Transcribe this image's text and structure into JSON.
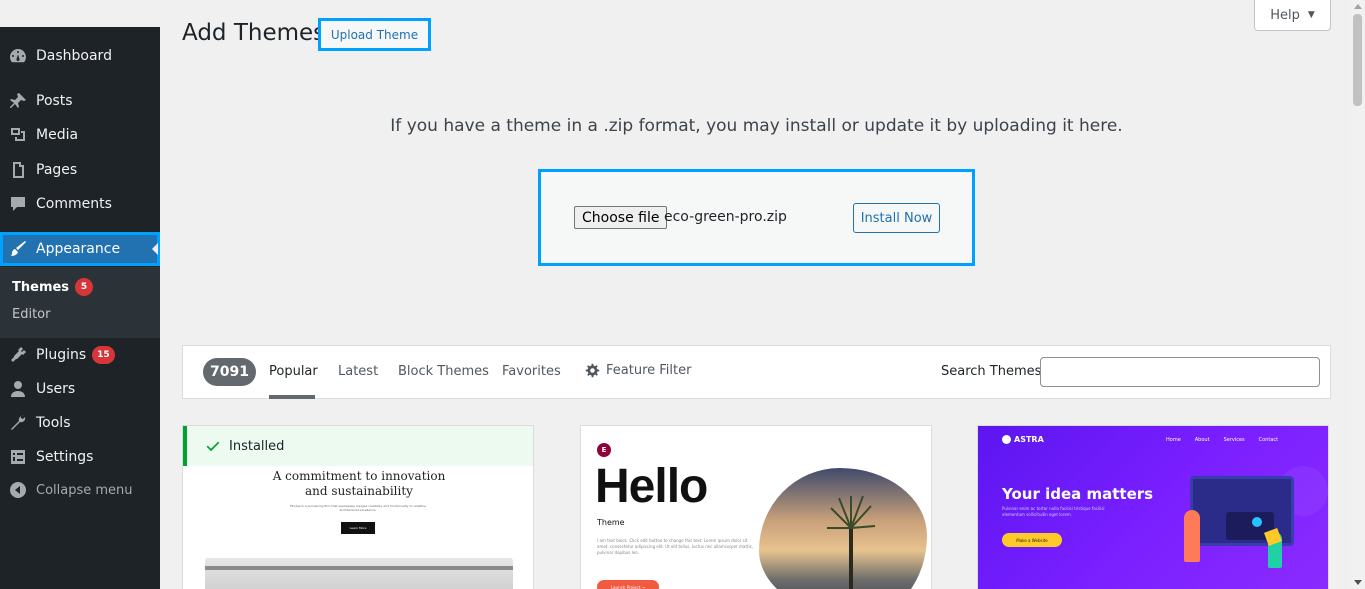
{
  "sidebar": {
    "items": [
      {
        "label": "Dashboard",
        "icon": "dashboard-icon"
      },
      {
        "label": "Posts",
        "icon": "pin-icon"
      },
      {
        "label": "Media",
        "icon": "media-icon"
      },
      {
        "label": "Pages",
        "icon": "pages-icon"
      },
      {
        "label": "Comments",
        "icon": "comments-icon"
      },
      {
        "label": "Appearance",
        "icon": "brush-icon",
        "active": true
      },
      {
        "label": "Plugins",
        "icon": "plugin-icon",
        "badge": "15"
      },
      {
        "label": "Users",
        "icon": "users-icon"
      },
      {
        "label": "Tools",
        "icon": "wrench-icon"
      },
      {
        "label": "Settings",
        "icon": "settings-icon"
      },
      {
        "label": "Collapse menu",
        "icon": "collapse-icon"
      }
    ],
    "submenu": {
      "themes_label": "Themes",
      "themes_badge": "5",
      "editor_label": "Editor"
    }
  },
  "header": {
    "title": "Add Themes",
    "upload_button": "Upload Theme",
    "help_button": "Help"
  },
  "upload": {
    "description": "If you have a theme in a .zip format, you may install or update it by uploading it here.",
    "choose_file_label": "Choose file",
    "file_name": "eco-green-pro.zip",
    "install_button": "Install Now"
  },
  "filter_bar": {
    "count": "7091",
    "tabs": [
      "Popular",
      "Latest",
      "Block Themes",
      "Favorites"
    ],
    "current_tab": "Popular",
    "feature_filter": "Feature Filter",
    "search_label": "Search Themes",
    "search_value": ""
  },
  "themes": {
    "installed_label": "Installed",
    "card1": {
      "headline_1": "A commitment to innovation",
      "headline_2": "and sustainability",
      "small_text": "Études is a pioneering firm that seamlessly merges creativity and functionality to redefine architectural excellence.",
      "button": "Learn More"
    },
    "card2": {
      "logo": "E",
      "title": "Hello",
      "subtitle": "Theme",
      "body": "I am text block. Click edit button to change this text. Lorem ipsum dolor sit amet, consectetur adipiscing elit. Ut elit tellus, luctus nec ullamcorper mattis, pulvinar dapibus leo.",
      "button": "Launch Project →"
    },
    "card3": {
      "logo": "ASTRA",
      "nav": [
        "Home",
        "About",
        "Services",
        "Contact"
      ],
      "title": "Your idea matters",
      "sub": "Pulvinar enim ac tortor nulla facilisi tristique facilisi elementum sollicitudin eget lorem.",
      "button": "Make a Website"
    }
  },
  "colors": {
    "sidebar_bg": "#1d2327",
    "active_bg": "#2271b1",
    "highlight_outline": "#00a0ff",
    "badge": "#d63638",
    "installed_green": "#00a32a"
  }
}
